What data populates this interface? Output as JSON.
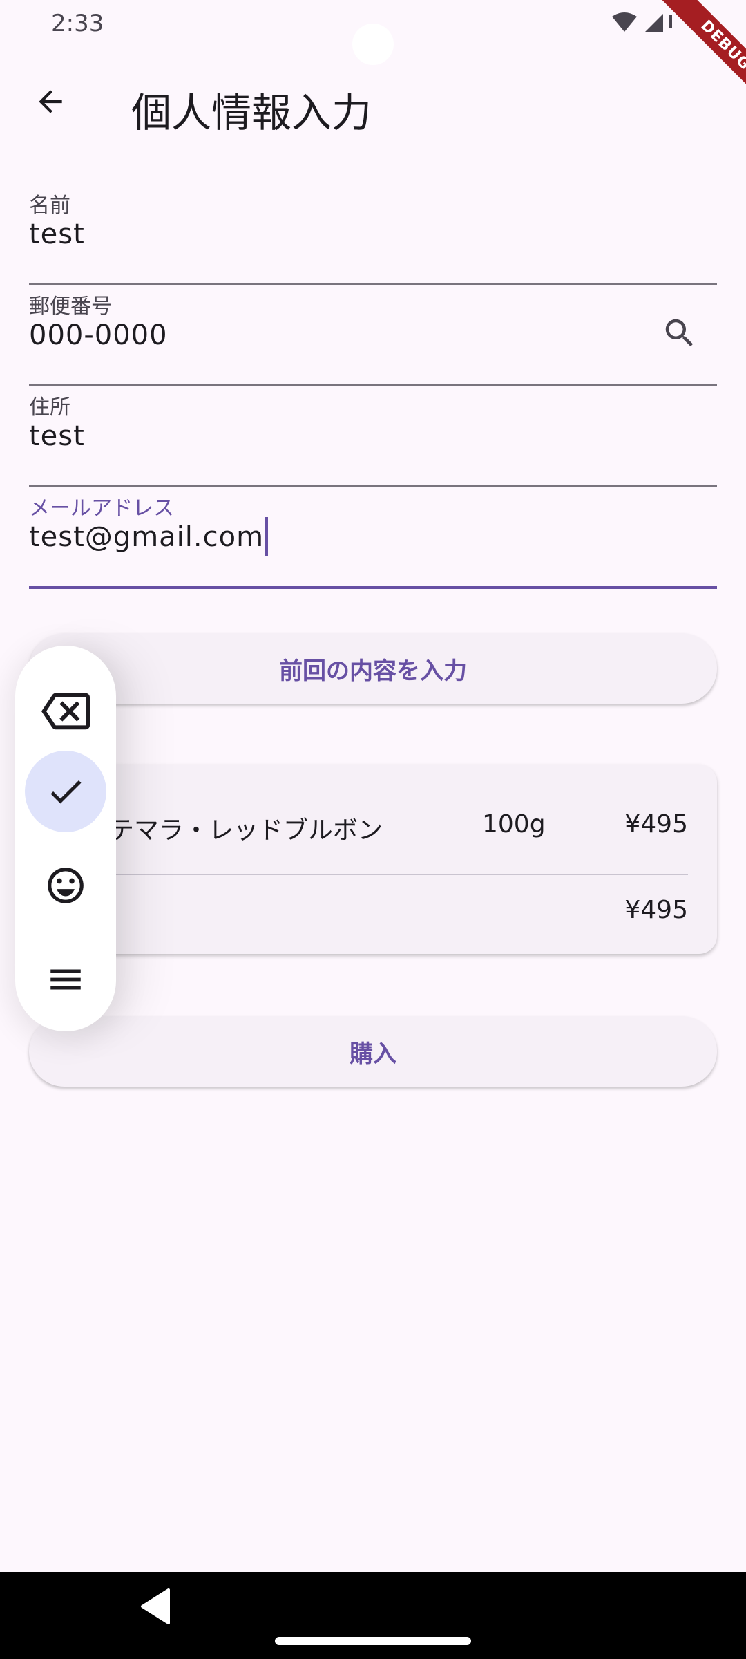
{
  "status_bar": {
    "time": "2:33",
    "debug_label": "DEBUG"
  },
  "app_bar": {
    "title": "個人情報入力",
    "back_icon": "arrow-back-icon"
  },
  "form": {
    "name": {
      "label": "名前",
      "value": "test"
    },
    "postal": {
      "label": "郵便番号",
      "value": "000-0000",
      "icon": "search-icon"
    },
    "address": {
      "label": "住所",
      "value": "test"
    },
    "email": {
      "label": "メールアドレス",
      "value": "test@gmail.com"
    }
  },
  "buttons": {
    "prefill": "前回の内容を入力",
    "purchase": "購入"
  },
  "order": {
    "item_name": "テマラ・レッドブルボン",
    "item_weight": "100g",
    "item_price": "¥495",
    "total": "¥495"
  },
  "toolbar": {
    "items": [
      "backspace-icon",
      "check-icon",
      "emoji-icon",
      "menu-icon"
    ],
    "active_index": 1
  },
  "colors": {
    "primary": "#6750a4",
    "background": "#fdf7fd",
    "surface": "#f6f0f7",
    "active_chip": "#dfe3fb"
  }
}
